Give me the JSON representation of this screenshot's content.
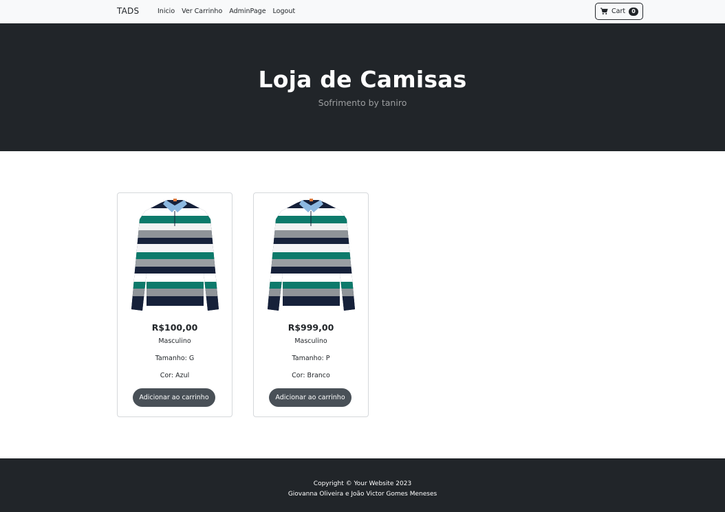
{
  "navbar": {
    "brand": "TADS",
    "links": [
      {
        "label": "Inicio"
      },
      {
        "label": "Ver Carrinho"
      },
      {
        "label": "AdminPage"
      },
      {
        "label": "Logout"
      }
    ],
    "cart": {
      "label": "Cart",
      "count": "0",
      "icon": "cart-icon"
    }
  },
  "hero": {
    "title": "Loja de Camisas",
    "subtitle": "Sofrimento by taniro"
  },
  "products": [
    {
      "price": "R$100,00",
      "gender": "Masculino",
      "size": "Tamanho: G",
      "color": "Cor: Azul",
      "button": "Adicionar ao carrinho",
      "image": "striped-polo-shirt"
    },
    {
      "price": "R$999,00",
      "gender": "Masculino",
      "size": "Tamanho: P",
      "color": "Cor: Branco",
      "button": "Adicionar ao carrinho",
      "image": "striped-polo-shirt"
    }
  ],
  "footer": {
    "copyright": "Copyright © Your Website 2023",
    "authors": "Giovanna Oliveira e João Victor Gomes Meneses"
  },
  "colors": {
    "dark": "#212529",
    "button": "#495057",
    "navbar_bg": "#f8f9fa",
    "shirt_green": "#0d7a6b",
    "shirt_navy": "#16213a",
    "shirt_gray": "#8f9499"
  }
}
